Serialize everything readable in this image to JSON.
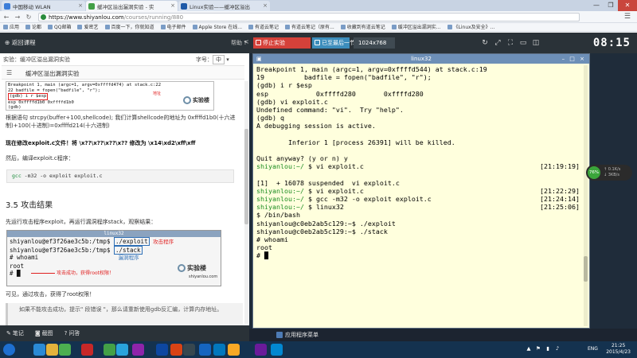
{
  "browser": {
    "tabs": [
      {
        "label": "中国移动 WLAN",
        "active": false,
        "color": "#3c7dd9"
      },
      {
        "label": "缓冲区溢出漏洞实验 - 实",
        "active": true,
        "color": "#43a047"
      },
      {
        "label": "Linux实验——缓冲区溢出",
        "active": false,
        "color": "#1e5aa8"
      }
    ],
    "window_controls": [
      "—",
      "❐",
      "✕"
    ],
    "url_host": "https://www.shiyanlou.com",
    "url_path": "/courses/running/880",
    "bookmarks": [
      "应用",
      "论都",
      "QQ邮箱",
      "爱密艺",
      "百度一下，你就知道",
      "电子邮件",
      "Apple Store 在线...",
      "有道云笔记",
      "有道云笔记（原有...",
      "收藏到有道云笔记",
      "缓冲区溢出漏洞实...",
      "《Linux及安全》..."
    ]
  },
  "labbar": {
    "back": "返回课程",
    "help": "帮助",
    "collapse": "<",
    "stop": "停止实验",
    "next": "已至最后一节",
    "resolution": "1024x768",
    "right_icons": [
      "↻",
      "⤢",
      "⛶",
      "▭",
      "◫"
    ],
    "clock": "08:15"
  },
  "doc": {
    "experiment_label": "实验：缓冲区溢出漏洞实验",
    "font_size_label": "字号：",
    "font_size_value": "中",
    "menu_icon": "☰",
    "title": "缓冲区溢出漏洞实验",
    "ss1_lines": [
      "Breakpoint 1, main (argc=1, argv=0xffffd474) at stack.c:22",
      "22          badfile = fopen(\"badfile\", \"r\");",
      "(gdb) i r $esp",
      "esp           0xffffd1b0      0xffffd1b0",
      "(gdb) "
    ],
    "ss1_note": "地址",
    "logo_text": "实验楼",
    "para1": "根据语句 strcpy(buffer+100,shellcode); 我们计算shellcode的地址为 0xffffd1b0(十六进制)+100(十进制)=0xffffd214(十六进制)",
    "para2": "现在修改exploit.c文件！将 \\x??\\x??\\x??\\x?? 修改为 \\x14\\xd2\\xff\\xff",
    "para3": "然后，编译exploit.c程序：",
    "code_kw": "gcc",
    "code_rest": " -m32 -o exploit exploit.c",
    "h33": "3.5 攻击结果",
    "para4": "先运行攻击程序exploit，再运行漏洞程序stack，观察结果：",
    "ss2_title": "linux32",
    "ss2_prompt1": "shiyanlou@ef3f26ae3c5b:/tmp$ ",
    "ss2_cmd1": "./exploit",
    "ss2_lbl1": "攻击程序",
    "ss2_prompt2": "shiyanlou@ef3f26ae3c5b:/tmp$ ",
    "ss2_cmd2": "./stack",
    "ss2_lbl2": "漏洞程序",
    "ss2_l3": "# whoami",
    "ss2_l4": "root",
    "ss2_l5": "# ",
    "ss2_ok": "攻击成功，获得root权限！",
    "ss2_logo_sub": "shiyanlou.com",
    "para5": "可见，通过攻击，获得了root权限！",
    "quote": "如果不能攻击成功，提示\" 段错误 \"，那么请重新使用gdb反汇编，计算内存地址。",
    "foot": [
      {
        "icon": "✎",
        "label": "笔记"
      },
      {
        "icon": "◙",
        "label": "截图"
      },
      {
        "icon": "?",
        "label": "问答"
      }
    ]
  },
  "terminal": {
    "title": "linux32",
    "title_left": "▣",
    "title_right": "– □ ×",
    "lines": [
      {
        "t": "Breakpoint 1, main (argc=1, argv=0xffffd544) at stack.c:19"
      },
      {
        "t": "19          badfile = fopen(\"badfile\", \"r\");"
      },
      {
        "t": "(gdb) i r $esp"
      },
      {
        "t": "esp            0xffffd280       0xffffd280"
      },
      {
        "t": "(gdb) vi exploit.c"
      },
      {
        "t": "Undefined command: \"vi\".  Try \"help\"."
      },
      {
        "t": "(gdb) q"
      },
      {
        "t": "A debugging session is active."
      },
      {
        "t": ""
      },
      {
        "t": "        Inferior 1 [process 26391] will be killed."
      },
      {
        "t": ""
      },
      {
        "t": "Quit anyway? (y or n) y"
      },
      {
        "p": "shiyanlou:~/",
        "t": " $ vi exploit.c",
        "ts": "[21:19:19]"
      },
      {
        "t": ""
      },
      {
        "t": "[1]  + 16078 suspended  vi exploit.c"
      },
      {
        "p": "shiyanlou:~/",
        "t": " $ vi exploit.c",
        "ts": "[21:22:29]"
      },
      {
        "p": "shiyanlou:~/",
        "t": " $ gcc -m32 -o exploit exploit.c",
        "ts": "[21:24:14]"
      },
      {
        "p": "shiyanlou:~/",
        "t": " $ linux32",
        "ts": "[21:25:06]"
      },
      {
        "t": "$ /bin/bash"
      },
      {
        "t": "shiyanlou@c0eb2ab5c129:~$ ./exploit"
      },
      {
        "t": "shiyanlou@c0eb2ab5c129:~$ ./stack"
      },
      {
        "t": "# whoami"
      },
      {
        "t": "root"
      },
      {
        "t": "# █"
      }
    ],
    "app_menu": "应用程序菜单"
  },
  "netwidget": {
    "pct": "76%",
    "up": "0.1K/s",
    "down": "3KB/s"
  },
  "taskbar": {
    "icons": [
      {
        "name": "start",
        "color": "#1e6fd0"
      },
      {
        "name": "ie",
        "color": "#2a8ad6"
      },
      {
        "name": "folder",
        "color": "#e3b23c"
      },
      {
        "name": "chrome",
        "color": "#4caf50"
      },
      {
        "name": "cmb",
        "color": "#c62828"
      },
      {
        "name": "wechat",
        "color": "#43a047"
      },
      {
        "name": "qq",
        "color": "#29a3dd"
      },
      {
        "name": "pp",
        "color": "#8e24aa"
      },
      {
        "name": "ps",
        "color": "#0d47a1"
      },
      {
        "name": "ppt",
        "color": "#d84315"
      },
      {
        "name": "lr",
        "color": "#37474f"
      },
      {
        "name": "word",
        "color": "#1565c0"
      },
      {
        "name": "ie2",
        "color": "#0277bd"
      },
      {
        "name": "folder2",
        "color": "#f9a825"
      },
      {
        "name": "vs",
        "color": "#6a1b9a"
      },
      {
        "name": "email",
        "color": "#0288d1"
      }
    ],
    "lang": "ENG",
    "time": "21:25",
    "date": "2015/4/23"
  }
}
